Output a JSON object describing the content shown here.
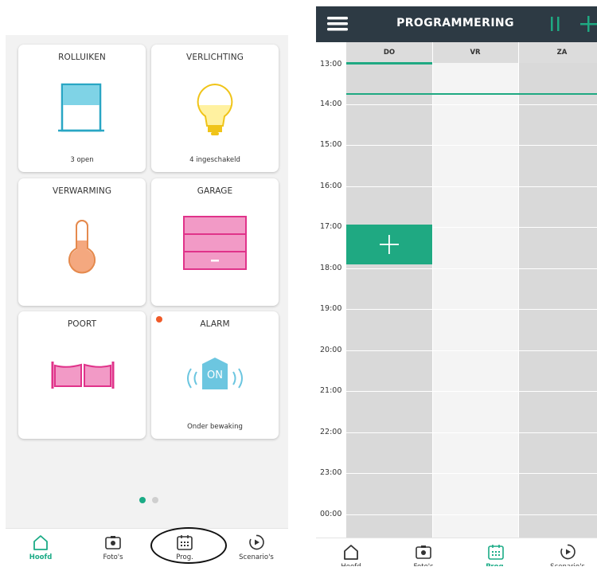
{
  "colors": {
    "accent": "#1fa982",
    "topbar": "#2d3a44",
    "blind": "#7fd3e6",
    "blind_frame": "#29a6c4",
    "bulb": "#fff1a0",
    "thermo": "#f4a87f",
    "garage": "#f29ac6",
    "garage_stroke": "#e0338a",
    "alarm": "#6cc6e0",
    "notif": "#f05a28",
    "dot_active": "#1bab86",
    "dot_inactive": "#cfcfcf"
  },
  "home": {
    "tiles": [
      {
        "title": "ROLLUIKEN",
        "status": "3 open",
        "icon": "roller-shutter-icon"
      },
      {
        "title": "VERLICHTING",
        "status": "4 ingeschakeld",
        "icon": "light-bulb-icon"
      },
      {
        "title": "VERWARMING",
        "status": "",
        "icon": "thermometer-icon"
      },
      {
        "title": "GARAGE",
        "status": "",
        "icon": "garage-door-icon"
      },
      {
        "title": "POORT",
        "status": "",
        "icon": "gate-icon"
      },
      {
        "title": "ALARM",
        "status": "Onder bewaking",
        "icon": "alarm-icon",
        "badge": "ON"
      }
    ],
    "pager": {
      "current": 1,
      "total": 2
    }
  },
  "tabs": [
    {
      "label": "Hoofd",
      "icon": "home-icon"
    },
    {
      "label": "Foto's",
      "icon": "camera-icon"
    },
    {
      "label": "Prog.",
      "icon": "calendar-icon"
    },
    {
      "label": "Scenario's",
      "icon": "play-icon"
    }
  ],
  "left_active_tab": "Hoofd",
  "right_active_tab": "Prog.",
  "programmering": {
    "title": "PROGRAMMERING",
    "days": [
      "DO",
      "VR",
      "ZA"
    ],
    "hours": [
      "13:00",
      "14:00",
      "15:00",
      "16:00",
      "17:00",
      "18:00",
      "19:00",
      "20:00",
      "21:00",
      "22:00",
      "23:00",
      "00:00"
    ],
    "add_slot": {
      "day": "DO",
      "start": "17:00",
      "end": "18:00"
    }
  }
}
